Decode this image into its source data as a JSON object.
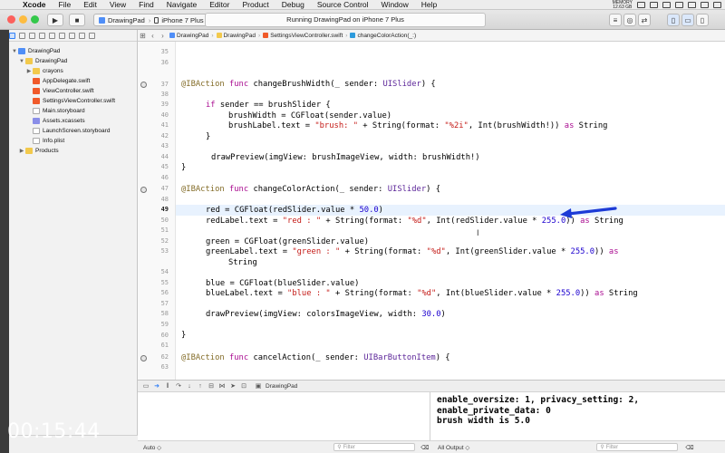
{
  "menubar": {
    "app": "Xcode",
    "items": [
      "File",
      "Edit",
      "View",
      "Find",
      "Navigate",
      "Editor",
      "Product",
      "Debug",
      "Source Control",
      "Window",
      "Help"
    ],
    "memory_label": "MEMORY",
    "memory_value": "12.63 GB"
  },
  "toolbar": {
    "scheme": "DrawingPad",
    "device": "iPhone 7 Plus",
    "activity": "Running DrawingPad on iPhone 7 Plus"
  },
  "navigator": {
    "items": [
      {
        "label": "DrawingPad",
        "icon": "project-icon"
      },
      {
        "label": "DrawingPad",
        "icon": "folder-icon"
      },
      {
        "label": "crayons",
        "icon": "folder-icon"
      },
      {
        "label": "AppDelegate.swift",
        "icon": "swift-file-icon"
      },
      {
        "label": "ViewController.swift",
        "icon": "swift-file-icon"
      },
      {
        "label": "SettingsViewController.swift",
        "icon": "swift-file-icon"
      },
      {
        "label": "Main.storyboard",
        "icon": "storyboard-icon"
      },
      {
        "label": "Assets.xcassets",
        "icon": "assets-icon"
      },
      {
        "label": "LaunchScreen.storyboard",
        "icon": "storyboard-icon"
      },
      {
        "label": "Info.plist",
        "icon": "plist-icon"
      },
      {
        "label": "Products",
        "icon": "folder-icon"
      }
    ]
  },
  "jumpbar": {
    "crumbs": [
      "DrawingPad",
      "DrawingPad",
      "SettingsViewController.swift",
      "changeColorAction(_:)"
    ]
  },
  "editor": {
    "line_numbers": [
      "35",
      "36",
      "37",
      "38",
      "39",
      "40",
      "41",
      "42",
      "43",
      "44",
      "45",
      "46",
      "47",
      "48",
      "49",
      "50",
      "51",
      "52",
      "53",
      "54",
      "55",
      "56",
      "57",
      "58",
      "59",
      "60",
      "61",
      "62",
      "63"
    ],
    "breakpoint_lines": [
      "37",
      "47",
      "62"
    ],
    "current_line": "49",
    "code": {
      "l37": [
        "@IBAction",
        " func ",
        "changeBrushWidth(_ sender: ",
        "UISlider",
        ") {"
      ],
      "l39": [
        "if",
        " sender == brushSlider {"
      ],
      "l40": "brushWidth = CGFloat(sender.value)",
      "l41": [
        "brushLabel.text = ",
        "\"brush: \"",
        " + String(format: ",
        "\"%2i\"",
        ", Int(brushWidth!)) ",
        "as",
        " String"
      ],
      "l42": "}",
      "l44": "drawPreview(imgView: brushImageView, width: brushWidth!)",
      "l45": "}",
      "l47": [
        "@IBAction",
        " func ",
        "changeColorAction(_ sender: ",
        "UISlider",
        ") {"
      ],
      "l49": [
        "red = CGFloat(redSlider.value * ",
        "50.0",
        ")"
      ],
      "l50": [
        "redLabel.text = ",
        "\"red : \"",
        " + String(format: ",
        "\"%d\"",
        ", Int(redSlider.value * ",
        "255.0",
        ")) ",
        "as",
        " String"
      ],
      "l52": "green = CGFloat(greenSlider.value)",
      "l53": [
        "greenLabel.text = ",
        "\"green : \"",
        " + String(format: ",
        "\"%d\"",
        ", Int(greenSlider.value * ",
        "255.0",
        ")) ",
        "as"
      ],
      "l53b": "String",
      "l55": "blue = CGFloat(blueSlider.value)",
      "l56": [
        "blueLabel.text = ",
        "\"blue : \"",
        " + String(format: ",
        "\"%d\"",
        ", Int(blueSlider.value * ",
        "255.0",
        ")) ",
        "as",
        " String"
      ],
      "l58": [
        "drawPreview(imgView: colorsImageView, width: ",
        "30.0",
        ")"
      ],
      "l60": "}",
      "l62": [
        "@IBAction",
        " func ",
        "cancelAction(_ sender: ",
        "UIBarButtonItem",
        ") {"
      ]
    }
  },
  "debugbar": {
    "target": "DrawingPad"
  },
  "variables": {
    "scope": "Auto ◇",
    "filter_placeholder": "Filter"
  },
  "console": {
    "lines": [
      "enable_oversize: 1, privacy_setting: 2,",
      "enable_private_data: 0",
      "brush width is 5.0"
    ],
    "output_label": "All Output ◇",
    "filter_placeholder": "Filter"
  },
  "overlay": {
    "timestamp": "00:15:44"
  },
  "colors": {
    "keyword": "#aa0d91",
    "attribute": "#836c28",
    "type": "#5c2699",
    "string": "#c41a16",
    "number": "#1c00cf",
    "arrow": "#1d3bd6",
    "current_line_bg": "#e8f2fe"
  }
}
